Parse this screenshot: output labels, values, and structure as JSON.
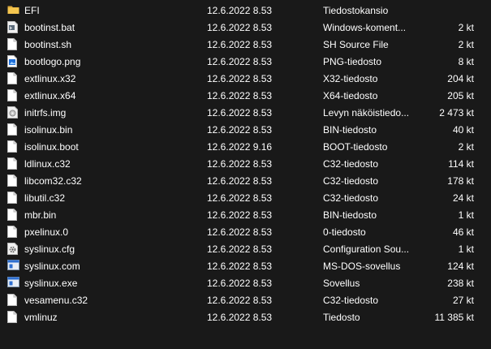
{
  "files": [
    {
      "name": "EFI",
      "date": "12.6.2022 8.53",
      "type": "Tiedostokansio",
      "size": "",
      "icon": "folder-icon"
    },
    {
      "name": "bootinst.bat",
      "date": "12.6.2022 8.53",
      "type": "Windows-koment...",
      "size": "2 kt",
      "icon": "batch-file-icon"
    },
    {
      "name": "bootinst.sh",
      "date": "12.6.2022 8.53",
      "type": "SH Source File",
      "size": "2 kt",
      "icon": "file-icon"
    },
    {
      "name": "bootlogo.png",
      "date": "12.6.2022 8.53",
      "type": "PNG-tiedosto",
      "size": "8 kt",
      "icon": "image-file-icon"
    },
    {
      "name": "extlinux.x32",
      "date": "12.6.2022 8.53",
      "type": "X32-tiedosto",
      "size": "204 kt",
      "icon": "file-icon"
    },
    {
      "name": "extlinux.x64",
      "date": "12.6.2022 8.53",
      "type": "X64-tiedosto",
      "size": "205 kt",
      "icon": "file-icon"
    },
    {
      "name": "initrfs.img",
      "date": "12.6.2022 8.53",
      "type": "Levyn näköistiedo...",
      "size": "2 473 kt",
      "icon": "disk-image-icon"
    },
    {
      "name": "isolinux.bin",
      "date": "12.6.2022 8.53",
      "type": "BIN-tiedosto",
      "size": "40 kt",
      "icon": "file-icon"
    },
    {
      "name": "isolinux.boot",
      "date": "12.6.2022 9.16",
      "type": "BOOT-tiedosto",
      "size": "2 kt",
      "icon": "file-icon"
    },
    {
      "name": "ldlinux.c32",
      "date": "12.6.2022 8.53",
      "type": "C32-tiedosto",
      "size": "114 kt",
      "icon": "file-icon"
    },
    {
      "name": "libcom32.c32",
      "date": "12.6.2022 8.53",
      "type": "C32-tiedosto",
      "size": "178 kt",
      "icon": "file-icon"
    },
    {
      "name": "libutil.c32",
      "date": "12.6.2022 8.53",
      "type": "C32-tiedosto",
      "size": "24 kt",
      "icon": "file-icon"
    },
    {
      "name": "mbr.bin",
      "date": "12.6.2022 8.53",
      "type": "BIN-tiedosto",
      "size": "1 kt",
      "icon": "file-icon"
    },
    {
      "name": "pxelinux.0",
      "date": "12.6.2022 8.53",
      "type": "0-tiedosto",
      "size": "46 kt",
      "icon": "file-icon"
    },
    {
      "name": "syslinux.cfg",
      "date": "12.6.2022 8.53",
      "type": "Configuration Sou...",
      "size": "1 kt",
      "icon": "config-file-icon"
    },
    {
      "name": "syslinux.com",
      "date": "12.6.2022 8.53",
      "type": "MS-DOS-sovellus",
      "size": "124 kt",
      "icon": "application-icon"
    },
    {
      "name": "syslinux.exe",
      "date": "12.6.2022 8.53",
      "type": "Sovellus",
      "size": "238 kt",
      "icon": "application-icon"
    },
    {
      "name": "vesamenu.c32",
      "date": "12.6.2022 8.53",
      "type": "C32-tiedosto",
      "size": "27 kt",
      "icon": "file-icon"
    },
    {
      "name": "vmlinuz",
      "date": "12.6.2022 8.53",
      "type": "Tiedosto",
      "size": "11 385 kt",
      "icon": "file-icon"
    }
  ],
  "colors": {
    "background": "#191919",
    "text": "#ffffff",
    "folder": "#f0c24a",
    "accent_blue": "#2d6fd1"
  }
}
